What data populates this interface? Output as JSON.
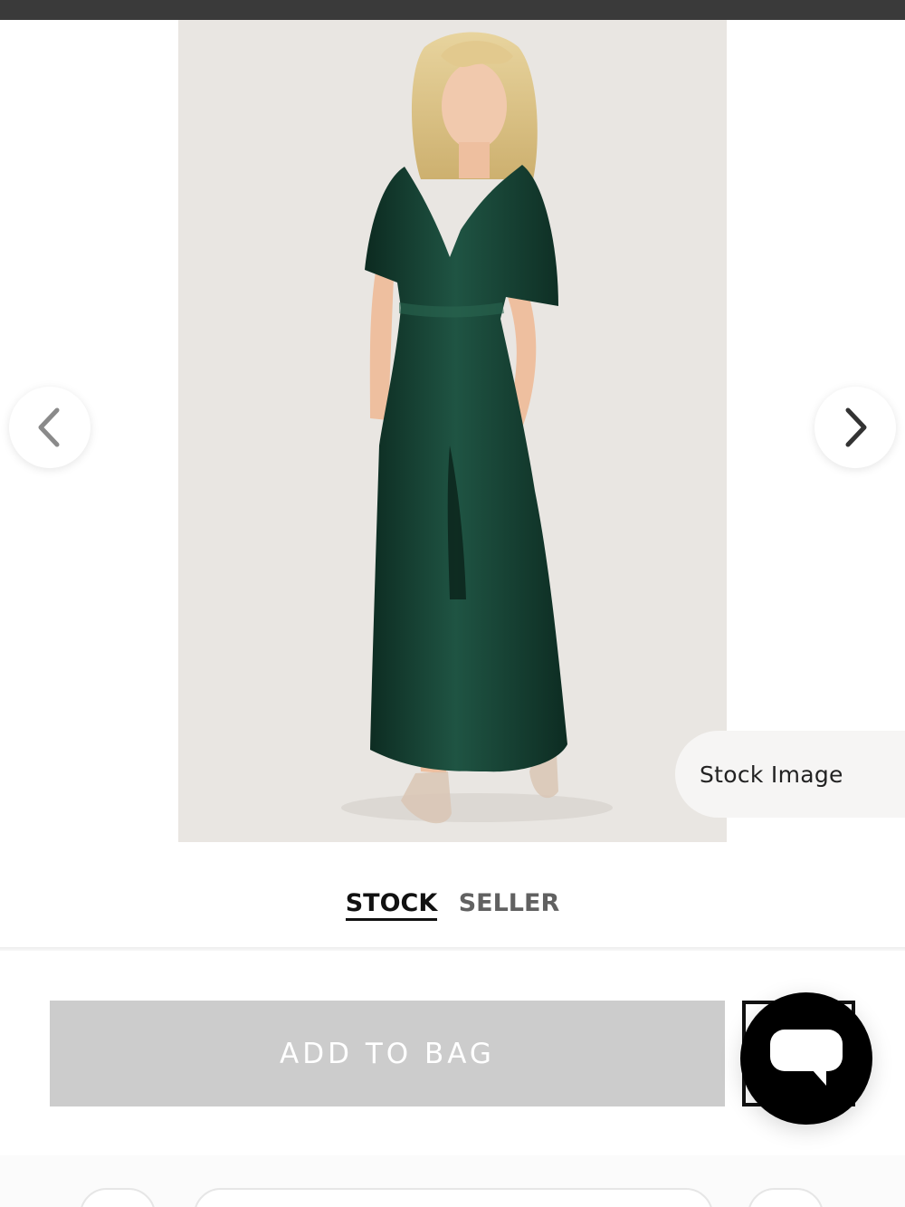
{
  "gallery": {
    "prev_icon": "chevron-left-icon",
    "next_icon": "chevron-right-icon",
    "badge": "Stock Image",
    "dress_color": "#143a2e",
    "background_color": "#e9e6e2"
  },
  "image_toggle": {
    "options": [
      "STOCK",
      "SELLER"
    ],
    "selected": "STOCK"
  },
  "actions": {
    "add_to_bag": "ADD TO BAG",
    "chat_icon": "chat-bubble-icon"
  },
  "colors": {
    "add_button_bg": "#cccccc",
    "chat_button_bg": "#000000",
    "top_bar": "#3a3a3a"
  }
}
